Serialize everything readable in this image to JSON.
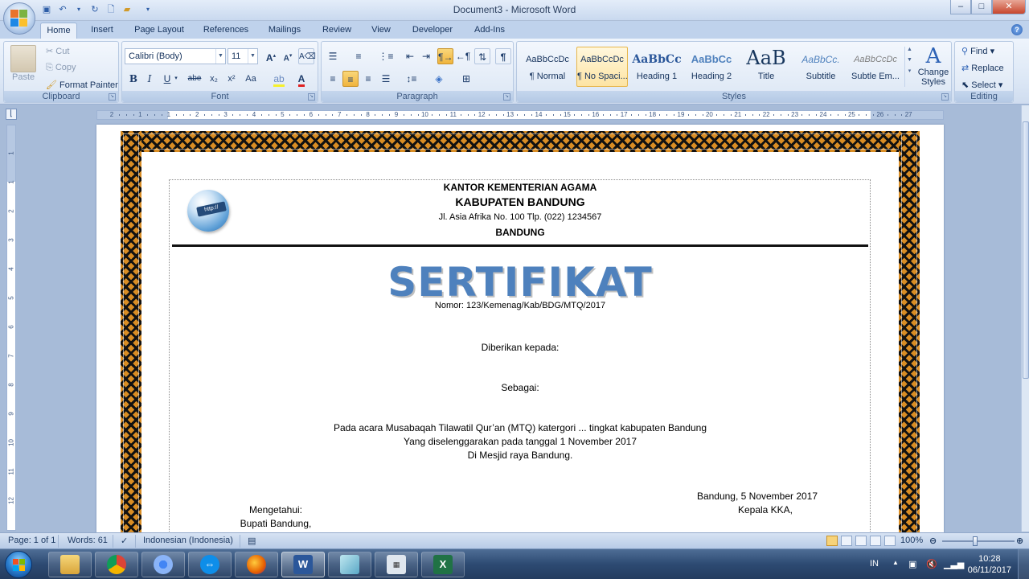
{
  "window": {
    "title": "Document3 - Microsoft Word",
    "min": "–",
    "max": "□",
    "close": "✕"
  },
  "qat": {
    "save": "save-icon",
    "undo": "undo-icon",
    "redo": "redo-icon",
    "new": "new-document-icon",
    "open": "open-folder-icon",
    "customize": "▾"
  },
  "tabs": [
    "Home",
    "Insert",
    "Page Layout",
    "References",
    "Mailings",
    "Review",
    "View",
    "Developer",
    "Add-Ins"
  ],
  "ribbon": {
    "clipboard": {
      "label": "Clipboard",
      "paste": "Paste",
      "cut": "Cut",
      "copy": "Copy",
      "format_painter": "Format Painter"
    },
    "font": {
      "label": "Font",
      "name": "Calibri (Body)",
      "size": "11",
      "bold": "B",
      "italic": "I",
      "underline": "U",
      "strike": "abe",
      "sub": "x₂",
      "sup": "x²",
      "case": "Aa",
      "grow": "A",
      "shrink": "A"
    },
    "paragraph": {
      "label": "Paragraph"
    },
    "styles": {
      "label": "Styles",
      "items": [
        {
          "preview": "AaBbCcDc",
          "name": "¶ Normal"
        },
        {
          "preview": "AaBbCcDc",
          "name": "¶ No Spaci..."
        },
        {
          "preview": "AaBbCc",
          "name": "Heading 1"
        },
        {
          "preview": "AaBbCc",
          "name": "Heading 2"
        },
        {
          "preview": "AaB",
          "name": "Title"
        },
        {
          "preview": "AaBbCc.",
          "name": "Subtitle"
        },
        {
          "preview": "AaBbCcDc",
          "name": "Subtle Em..."
        }
      ],
      "change_styles": "Change Styles"
    },
    "editing": {
      "label": "Editing",
      "find": "Find",
      "replace": "Replace",
      "select": "Select"
    }
  },
  "ruler": {
    "ticks": [
      "2",
      "1",
      "1",
      "2",
      "3",
      "4",
      "5",
      "6",
      "7",
      "8",
      "9",
      "10",
      "11",
      "12",
      "13",
      "14",
      "15",
      "16",
      "17",
      "18",
      "19",
      "20",
      "21",
      "22",
      "23",
      "24",
      "25",
      "26",
      "27"
    ]
  },
  "vruler": {
    "ticks": [
      "1",
      "1",
      "2",
      "3",
      "4",
      "5",
      "6",
      "7",
      "8",
      "9",
      "10",
      "11",
      "12"
    ]
  },
  "document": {
    "office": "KANTOR KEMENTERIAN AGAMA",
    "regency": "KABUPATEN BANDUNG",
    "address": "Jl. Asia Afrika No. 100 Tlp. (022) 1234567",
    "city": "BANDUNG",
    "logo_text": "http://",
    "heading": "SERTIFIKAT",
    "number": "Nomor: 123/Kemenag/Kab/BDG/MTQ/2017",
    "given_to": "Diberikan kepada:",
    "as": "Sebagai:",
    "body_1": "Pada acara Musabaqah Tilawatil Qur’an (MTQ) katergori ... tingkat kabupaten Bandung",
    "body_2": "Yang diselenggarakan pada tanggal 1 November 2017",
    "body_3": "Di Mesjid raya Bandung.",
    "date_place": "Bandung, 5 November 2017",
    "head_title": "Kepala KKA,",
    "acknowledged": "Mengetahui:",
    "regent": "Bupati Bandung,"
  },
  "status": {
    "page": "Page: 1 of 1",
    "words": "Words: 61",
    "language": "Indonesian (Indonesia)",
    "zoom": "100%"
  },
  "taskbar": {
    "apps": [
      "explorer-icon",
      "chrome-icon",
      "chrome-icon",
      "teamviewer-icon",
      "firefox-icon",
      "word-icon",
      "app-icon",
      "calculator-icon",
      "excel-icon"
    ],
    "lang": "IN",
    "time": "10:28",
    "date": "06/11/2017"
  }
}
